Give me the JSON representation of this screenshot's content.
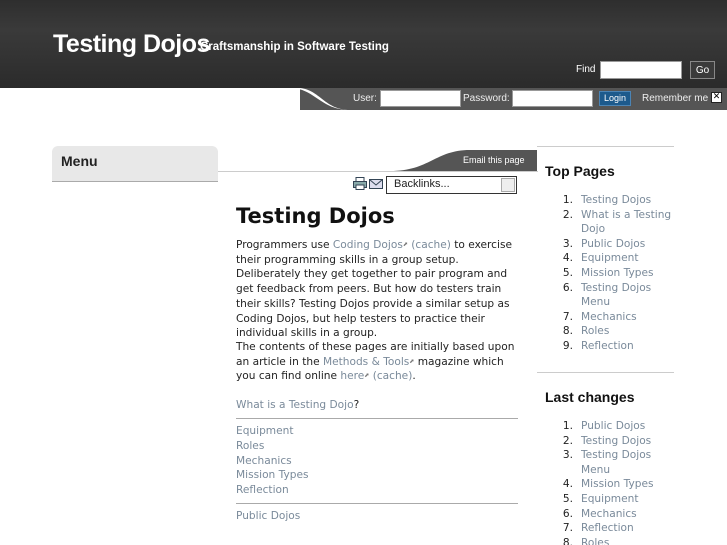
{
  "header": {
    "site_title": "Testing Dojos",
    "slogan": "Craftsmanship in Software Testing",
    "find_label": "Find",
    "find_button": "Go"
  },
  "login": {
    "user_label": "User:",
    "password_label": "Password:",
    "login_button": "Login",
    "remember_label": "Remember me"
  },
  "menu": {
    "title": "Menu"
  },
  "tabs": {
    "email": "Email this page"
  },
  "toolbar": {
    "backlinks": "Backlinks..."
  },
  "main": {
    "heading": "Testing Dojos",
    "p1_a": "Programmers use ",
    "p1_link1": "Coding Dojos",
    "p1_cache": "(cache)",
    "p1_b": " to exercise their programming skills in a group setup. Deliberately they get together to pair program and get feedback from peers. But how do testers train their skills? Testing Dojos provide a similar setup as Coding Dojos, but help testers to practice their individual skills in a group.",
    "p2_a": "The contents of these pages are initially based upon an article in the ",
    "p2_link1": "Methods & Tools",
    "p2_b": " magazine which you can find online ",
    "p2_link2": "here",
    "p2_cache": "(cache)",
    "p2_c": ".",
    "nav_question_link": "What is a Testing Dojo",
    "nav_question_mark": "?",
    "nav_items": [
      "Equipment",
      "Roles",
      "Mechanics",
      "Mission Types",
      "Reflection"
    ],
    "nav_last": "Public Dojos"
  },
  "top_pages": {
    "title": "Top Pages",
    "items": [
      "Testing Dojos",
      "What is a Testing Dojo",
      "Public Dojos",
      "Equipment",
      "Mission Types",
      "Testing Dojos Menu",
      "Mechanics",
      "Roles",
      "Reflection"
    ]
  },
  "last_changes": {
    "title": "Last changes",
    "items": [
      "Public Dojos",
      "Testing Dojos",
      "Testing Dojos Menu",
      "Mission Types",
      "Equipment",
      "Mechanics",
      "Reflection",
      "Roles"
    ]
  }
}
